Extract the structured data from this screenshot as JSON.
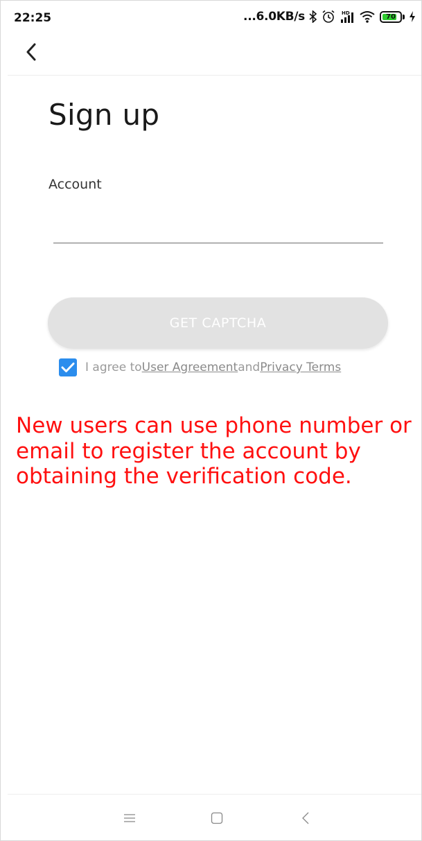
{
  "status_bar": {
    "time": "22:25",
    "network_speed": "...6.0KB/s",
    "battery_level": "70",
    "battery_color": "#2ecc2e",
    "icons": [
      "bluetooth-icon",
      "alarm-icon",
      "hd-signal-icon",
      "wifi-icon",
      "battery-icon",
      "charging-icon"
    ]
  },
  "nav": {
    "back_icon": "chevron-left-icon"
  },
  "signup": {
    "title": "Sign up",
    "account_label": "Account",
    "account_value": "",
    "captcha_button": "GET CAPTCHA",
    "agree": {
      "checked": true,
      "prefix": "I agree to",
      "user_agreement": "User Agreement",
      "conjunction": "and",
      "privacy_terms": "Privacy Terms"
    }
  },
  "annotation": "New users can use phone number or email to register the account by obtaining the verification code.",
  "system_nav": {
    "menu_icon": "menu-icon",
    "home_icon": "home-square-icon",
    "back_icon": "back-triangle-icon"
  },
  "colors": {
    "accent": "#2b8ded",
    "button_disabled": "#e2e2e2",
    "annotation": "#ff1010"
  }
}
